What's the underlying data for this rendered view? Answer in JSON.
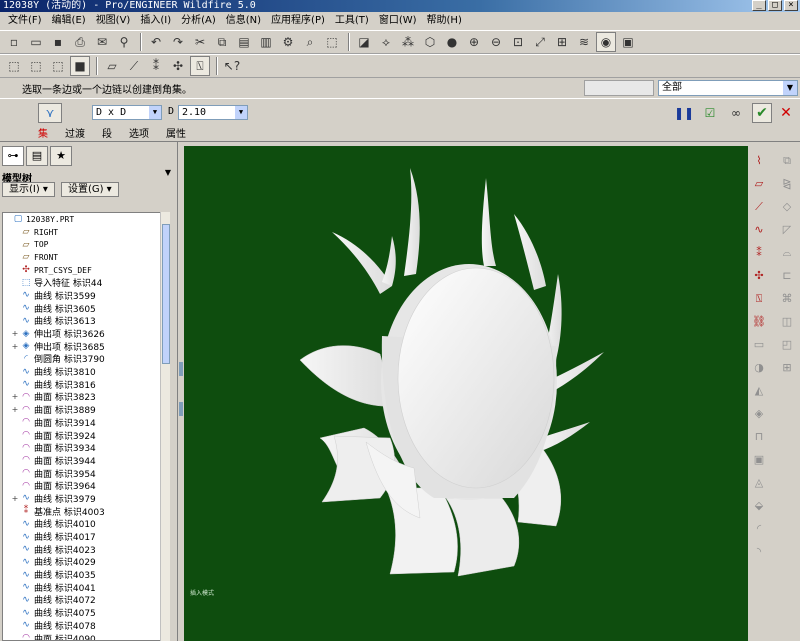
{
  "window": {
    "title": "12038Y (活动的) - Pro/ENGINEER Wildfire 5.0",
    "min_label": "_",
    "max_label": "□",
    "close_label": "×"
  },
  "menu": [
    "文件(F)",
    "编辑(E)",
    "视图(V)",
    "插入(I)",
    "分析(A)",
    "信息(N)",
    "应用程序(P)",
    "工具(T)",
    "窗口(W)",
    "帮助(H)"
  ],
  "prompt": {
    "message": "选取一条边或一个边链以创建倒角集。",
    "filter_value": "全部"
  },
  "dashboard": {
    "scheme_value": "D x D",
    "d_label": "D",
    "d_value": "2.10",
    "tabs": [
      "集",
      "过渡",
      "段",
      "选项",
      "属性"
    ],
    "ok_icon": "✔",
    "cancel_icon": "✕"
  },
  "model_tree": {
    "title": "模型树",
    "display_button": "显示(I) ▾",
    "settings_button": "设置(G) ▾",
    "items": [
      {
        "label": "12038Y.PRT",
        "icon": "part-icon",
        "expander": "",
        "mono": true
      },
      {
        "label": "RIGHT",
        "icon": "datum-plane-icon",
        "expander": "",
        "mono": true
      },
      {
        "label": "TOP",
        "icon": "datum-plane-icon",
        "expander": "",
        "mono": true
      },
      {
        "label": "FRONT",
        "icon": "datum-plane-icon",
        "expander": "",
        "mono": true
      },
      {
        "label": "PRT_CSYS_DEF",
        "icon": "csys-icon",
        "expander": "",
        "mono": true
      },
      {
        "label": "导入特征 标识44",
        "icon": "import-icon",
        "expander": ""
      },
      {
        "label": "曲线 标识3599",
        "icon": "curve-icon",
        "expander": ""
      },
      {
        "label": "曲线 标识3605",
        "icon": "curve-icon",
        "expander": ""
      },
      {
        "label": "曲线 标识3613",
        "icon": "curve-icon",
        "expander": ""
      },
      {
        "label": "伸出项 标识3626",
        "icon": "protrusion-icon",
        "expander": "+"
      },
      {
        "label": "伸出项 标识3685",
        "icon": "protrusion-icon",
        "expander": "+"
      },
      {
        "label": "倒圆角 标识3790",
        "icon": "round-icon",
        "expander": ""
      },
      {
        "label": "曲线 标识3810",
        "icon": "curve-icon",
        "expander": ""
      },
      {
        "label": "曲线 标识3816",
        "icon": "curve-icon",
        "expander": ""
      },
      {
        "label": "曲面 标识3823",
        "icon": "surface-icon",
        "expander": "+"
      },
      {
        "label": "曲面 标识3889",
        "icon": "surface-icon",
        "expander": "+"
      },
      {
        "label": "曲面 标识3914",
        "icon": "surface-icon",
        "expander": ""
      },
      {
        "label": "曲面 标识3924",
        "icon": "surface-icon",
        "expander": ""
      },
      {
        "label": "曲面 标识3934",
        "icon": "surface-icon",
        "expander": ""
      },
      {
        "label": "曲面 标识3944",
        "icon": "surface-icon",
        "expander": ""
      },
      {
        "label": "曲面 标识3954",
        "icon": "surface-icon",
        "expander": ""
      },
      {
        "label": "曲面 标识3964",
        "icon": "surface-icon",
        "expander": ""
      },
      {
        "label": "曲线 标识3979",
        "icon": "curve-icon",
        "expander": "+"
      },
      {
        "label": "基准点 标识4003",
        "icon": "datum-point-icon",
        "expander": ""
      },
      {
        "label": "曲线 标识4010",
        "icon": "curve-icon",
        "expander": ""
      },
      {
        "label": "曲线 标识4017",
        "icon": "curve-icon",
        "expander": ""
      },
      {
        "label": "曲线 标识4023",
        "icon": "curve-icon",
        "expander": ""
      },
      {
        "label": "曲线 标识4029",
        "icon": "curve-icon",
        "expander": ""
      },
      {
        "label": "曲线 标识4035",
        "icon": "curve-icon",
        "expander": ""
      },
      {
        "label": "曲线 标识4041",
        "icon": "curve-icon",
        "expander": ""
      },
      {
        "label": "曲线 标识4072",
        "icon": "curve-icon",
        "expander": ""
      },
      {
        "label": "曲线 标识4075",
        "icon": "curve-icon",
        "expander": ""
      },
      {
        "label": "曲线 标识4078",
        "icon": "curve-icon",
        "expander": ""
      },
      {
        "label": "曲面 标识4090",
        "icon": "surface-icon",
        "expander": ""
      }
    ]
  },
  "graphics": {
    "background": "#0e4d0e",
    "note": "插入模式"
  }
}
